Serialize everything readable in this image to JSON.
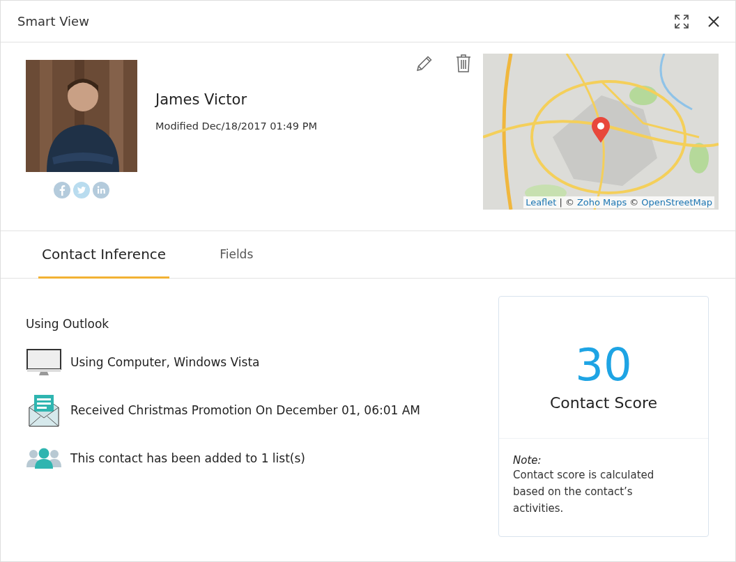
{
  "window": {
    "title": "Smart View"
  },
  "contact": {
    "name": "James Victor",
    "modified": "Modified Dec/18/2017 01:49 PM",
    "social": [
      {
        "kind": "facebook"
      },
      {
        "kind": "twitter"
      },
      {
        "kind": "linkedin"
      }
    ]
  },
  "map": {
    "kind": "picture",
    "attribution": [
      {
        "kind": "link",
        "text": "Leaflet"
      },
      {
        "kind": "text",
        "text": "| ©"
      },
      {
        "kind": "link",
        "text": "Zoho Maps"
      },
      {
        "kind": "text",
        "text": "©"
      },
      {
        "kind": "link",
        "text": "OpenStreetMap"
      }
    ]
  },
  "tabs": [
    {
      "label": "Contact Inference",
      "selected": true
    },
    {
      "label": "Fields",
      "selected": false
    }
  ],
  "activities": [
    {
      "kind": "heading",
      "text": "Using Outlook"
    },
    {
      "kind": "computer",
      "text": "Using Computer, Windows Vista"
    },
    {
      "kind": "email",
      "text": "Received Christmas Promotion On December 01, 06:01 AM"
    },
    {
      "kind": "group",
      "text": "This contact has been added to 1 list(s)"
    }
  ],
  "score": {
    "value": "30",
    "label": "Contact Score",
    "note_title": "Note:",
    "note": "Contact score is calculated based on the contact’s activities."
  }
}
